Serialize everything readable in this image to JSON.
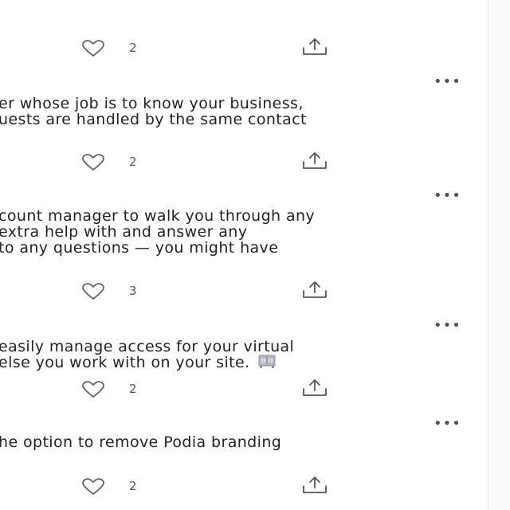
{
  "posts": [
    {
      "lines": [],
      "likes": "2",
      "icons": {
        "like": "heart-icon",
        "share": "share-icon"
      }
    },
    {
      "more": "•••",
      "lines": [
        "er whose job is to know your business,",
        "uests are handled by the same contact"
      ],
      "likes": "2",
      "icons": {
        "more": "more-options-icon",
        "like": "heart-icon",
        "share": "share-icon"
      }
    },
    {
      "more": "•••",
      "lines": [
        "count manager to walk you through any",
        "extra help with and answer any",
        "to any questions — you might have"
      ],
      "likes": "3",
      "icons": {
        "more": "more-options-icon",
        "like": "heart-icon",
        "share": "share-icon"
      }
    },
    {
      "more": "•••",
      "lines": [
        "easily manage access for your virtual",
        "else you work with on your site."
      ],
      "emoji": "file-cabinet-emoji",
      "likes": "2",
      "icons": {
        "more": "more-options-icon",
        "like": "heart-icon",
        "share": "share-icon"
      }
    },
    {
      "more": "•••",
      "lines": [
        "he option to remove Podia branding"
      ],
      "likes": "2",
      "icons": {
        "more": "more-options-icon",
        "like": "heart-icon",
        "share": "share-icon"
      }
    }
  ]
}
